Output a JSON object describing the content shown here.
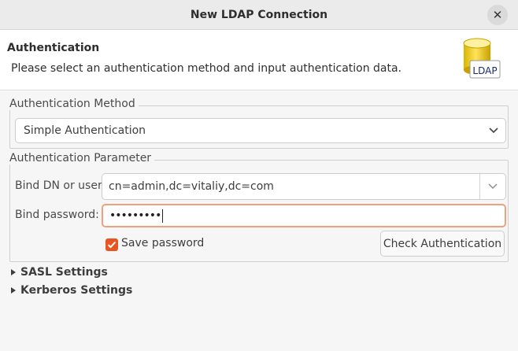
{
  "window": {
    "title": "New LDAP Connection",
    "close_icon": "close-icon"
  },
  "header": {
    "title": "Authentication",
    "description": "Please select an authentication method and input authentication data.",
    "logo_text": "LDAP"
  },
  "auth_method": {
    "legend": "Authentication Method",
    "selected": "Simple Authentication"
  },
  "auth_param": {
    "legend": "Authentication Parameter",
    "bind_dn_label": "Bind DN or user:",
    "bind_dn_value": "cn=admin,dc=vitaliy,dc=com",
    "bind_password_label": "Bind password:",
    "bind_password_mask": "•••••••••",
    "save_password_label": "Save password",
    "save_password_checked": true,
    "check_button_label": "Check Authentication"
  },
  "sections": {
    "sasl_label": "SASL Settings",
    "kerberos_label": "Kerberos Settings"
  },
  "colors": {
    "accent": "#e95420",
    "focus_border": "#f0a07a"
  }
}
